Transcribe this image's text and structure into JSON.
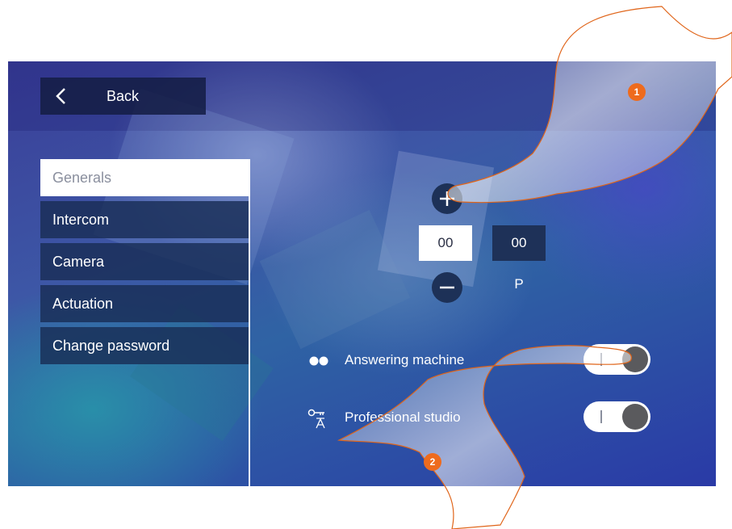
{
  "header": {
    "back_label": "Back"
  },
  "menu": {
    "items": [
      {
        "label": "Generals",
        "active": true
      },
      {
        "label": "Intercom",
        "active": false
      },
      {
        "label": "Camera",
        "active": false
      },
      {
        "label": "Actuation",
        "active": false
      },
      {
        "label": "Change password",
        "active": false
      }
    ]
  },
  "address_selector": {
    "left_value": "00",
    "right_value": "00",
    "right_label": "P"
  },
  "settings": [
    {
      "label": "Answering machine",
      "icon": "answering-machine-icon",
      "toggle": "on"
    },
    {
      "label": "Professional studio",
      "icon": "professional-studio-icon",
      "toggle": "on"
    }
  ],
  "callouts": {
    "step1": "1",
    "step2": "2"
  },
  "colors": {
    "callout": "#ee6b1d",
    "panel_dark": "#1d3157",
    "active_menu_text": "#8a8f9e"
  }
}
